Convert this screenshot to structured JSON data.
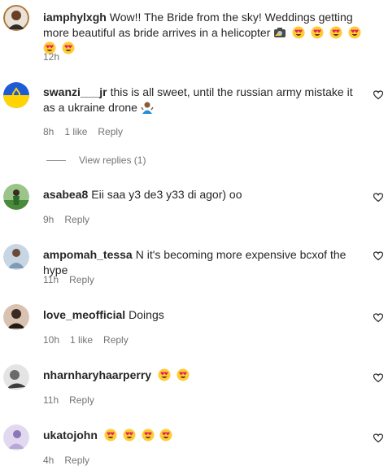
{
  "comments": [
    {
      "username": "iamphylxgh",
      "text": "Wow!! The Bride from the sky! Weddings getting more beautiful as bride arrives in a helicopter",
      "time": "12h",
      "likes": "",
      "reply": "",
      "avatar_color": "#8a5a3c",
      "emojis": [
        "camera-emoji",
        "heart-eyes",
        "heart-eyes",
        "heart-eyes",
        "heart-eyes",
        "heart-eyes",
        "heart-eyes"
      ]
    },
    {
      "username": "swanzi___jr",
      "text": "this is all sweet, until the russian army mistake it as a ukraine drone",
      "time": "8h",
      "likes": "1 like",
      "reply": "Reply",
      "avatar_color": "#1e5bd6",
      "emojis": [
        "person-shrug"
      ]
    },
    {
      "username": "asabea8",
      "text": "Eii saa y3 de3 y33 di agor) oo",
      "time": "9h",
      "likes": "",
      "reply": "Reply",
      "avatar_color": "#4a8a3a",
      "emojis": []
    },
    {
      "username": "ampomah_tessa",
      "text": "N it's becoming more expensive bcxof the hype",
      "time": "11h",
      "likes": "",
      "reply": "Reply",
      "avatar_color": "#7d9bb5",
      "emojis": []
    },
    {
      "username": "love_meofficial",
      "text": "Doings",
      "time": "10h",
      "likes": "1 like",
      "reply": "Reply",
      "avatar_color": "#3a2a22",
      "emojis": []
    },
    {
      "username": "nharnharyhaarperry",
      "text": "",
      "time": "11h",
      "likes": "",
      "reply": "Reply",
      "avatar_color": "#6a6a6a",
      "emojis": [
        "heart-eyes",
        "heart-eyes"
      ]
    },
    {
      "username": "ukatojohn",
      "text": "",
      "time": "4h",
      "likes": "",
      "reply": "Reply",
      "avatar_color": "#b8a8d8",
      "emojis": [
        "heart-eyes",
        "heart-eyes",
        "heart-eyes",
        "heart-eyes"
      ]
    }
  ],
  "view_replies": "View replies (1)",
  "colors": {
    "text": "#262626",
    "muted": "#737373",
    "heart_eyes_face": "#ffcc33",
    "heart_eyes_heart": "#e0245e"
  }
}
